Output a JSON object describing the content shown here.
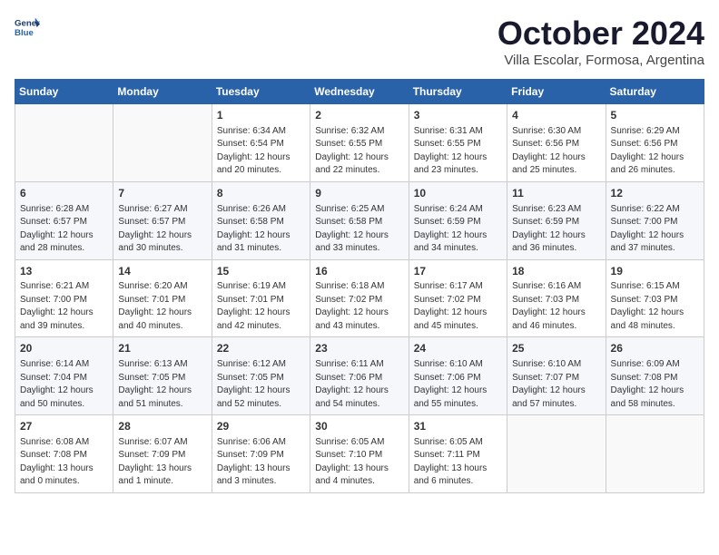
{
  "header": {
    "logo_line1": "General",
    "logo_line2": "Blue",
    "month": "October 2024",
    "location": "Villa Escolar, Formosa, Argentina"
  },
  "weekdays": [
    "Sunday",
    "Monday",
    "Tuesday",
    "Wednesday",
    "Thursday",
    "Friday",
    "Saturday"
  ],
  "weeks": [
    [
      {
        "day": "",
        "info": ""
      },
      {
        "day": "",
        "info": ""
      },
      {
        "day": "1",
        "info": "Sunrise: 6:34 AM\nSunset: 6:54 PM\nDaylight: 12 hours\nand 20 minutes."
      },
      {
        "day": "2",
        "info": "Sunrise: 6:32 AM\nSunset: 6:55 PM\nDaylight: 12 hours\nand 22 minutes."
      },
      {
        "day": "3",
        "info": "Sunrise: 6:31 AM\nSunset: 6:55 PM\nDaylight: 12 hours\nand 23 minutes."
      },
      {
        "day": "4",
        "info": "Sunrise: 6:30 AM\nSunset: 6:56 PM\nDaylight: 12 hours\nand 25 minutes."
      },
      {
        "day": "5",
        "info": "Sunrise: 6:29 AM\nSunset: 6:56 PM\nDaylight: 12 hours\nand 26 minutes."
      }
    ],
    [
      {
        "day": "6",
        "info": "Sunrise: 6:28 AM\nSunset: 6:57 PM\nDaylight: 12 hours\nand 28 minutes."
      },
      {
        "day": "7",
        "info": "Sunrise: 6:27 AM\nSunset: 6:57 PM\nDaylight: 12 hours\nand 30 minutes."
      },
      {
        "day": "8",
        "info": "Sunrise: 6:26 AM\nSunset: 6:58 PM\nDaylight: 12 hours\nand 31 minutes."
      },
      {
        "day": "9",
        "info": "Sunrise: 6:25 AM\nSunset: 6:58 PM\nDaylight: 12 hours\nand 33 minutes."
      },
      {
        "day": "10",
        "info": "Sunrise: 6:24 AM\nSunset: 6:59 PM\nDaylight: 12 hours\nand 34 minutes."
      },
      {
        "day": "11",
        "info": "Sunrise: 6:23 AM\nSunset: 6:59 PM\nDaylight: 12 hours\nand 36 minutes."
      },
      {
        "day": "12",
        "info": "Sunrise: 6:22 AM\nSunset: 7:00 PM\nDaylight: 12 hours\nand 37 minutes."
      }
    ],
    [
      {
        "day": "13",
        "info": "Sunrise: 6:21 AM\nSunset: 7:00 PM\nDaylight: 12 hours\nand 39 minutes."
      },
      {
        "day": "14",
        "info": "Sunrise: 6:20 AM\nSunset: 7:01 PM\nDaylight: 12 hours\nand 40 minutes."
      },
      {
        "day": "15",
        "info": "Sunrise: 6:19 AM\nSunset: 7:01 PM\nDaylight: 12 hours\nand 42 minutes."
      },
      {
        "day": "16",
        "info": "Sunrise: 6:18 AM\nSunset: 7:02 PM\nDaylight: 12 hours\nand 43 minutes."
      },
      {
        "day": "17",
        "info": "Sunrise: 6:17 AM\nSunset: 7:02 PM\nDaylight: 12 hours\nand 45 minutes."
      },
      {
        "day": "18",
        "info": "Sunrise: 6:16 AM\nSunset: 7:03 PM\nDaylight: 12 hours\nand 46 minutes."
      },
      {
        "day": "19",
        "info": "Sunrise: 6:15 AM\nSunset: 7:03 PM\nDaylight: 12 hours\nand 48 minutes."
      }
    ],
    [
      {
        "day": "20",
        "info": "Sunrise: 6:14 AM\nSunset: 7:04 PM\nDaylight: 12 hours\nand 50 minutes."
      },
      {
        "day": "21",
        "info": "Sunrise: 6:13 AM\nSunset: 7:05 PM\nDaylight: 12 hours\nand 51 minutes."
      },
      {
        "day": "22",
        "info": "Sunrise: 6:12 AM\nSunset: 7:05 PM\nDaylight: 12 hours\nand 52 minutes."
      },
      {
        "day": "23",
        "info": "Sunrise: 6:11 AM\nSunset: 7:06 PM\nDaylight: 12 hours\nand 54 minutes."
      },
      {
        "day": "24",
        "info": "Sunrise: 6:10 AM\nSunset: 7:06 PM\nDaylight: 12 hours\nand 55 minutes."
      },
      {
        "day": "25",
        "info": "Sunrise: 6:10 AM\nSunset: 7:07 PM\nDaylight: 12 hours\nand 57 minutes."
      },
      {
        "day": "26",
        "info": "Sunrise: 6:09 AM\nSunset: 7:08 PM\nDaylight: 12 hours\nand 58 minutes."
      }
    ],
    [
      {
        "day": "27",
        "info": "Sunrise: 6:08 AM\nSunset: 7:08 PM\nDaylight: 13 hours\nand 0 minutes."
      },
      {
        "day": "28",
        "info": "Sunrise: 6:07 AM\nSunset: 7:09 PM\nDaylight: 13 hours\nand 1 minute."
      },
      {
        "day": "29",
        "info": "Sunrise: 6:06 AM\nSunset: 7:09 PM\nDaylight: 13 hours\nand 3 minutes."
      },
      {
        "day": "30",
        "info": "Sunrise: 6:05 AM\nSunset: 7:10 PM\nDaylight: 13 hours\nand 4 minutes."
      },
      {
        "day": "31",
        "info": "Sunrise: 6:05 AM\nSunset: 7:11 PM\nDaylight: 13 hours\nand 6 minutes."
      },
      {
        "day": "",
        "info": ""
      },
      {
        "day": "",
        "info": ""
      }
    ]
  ]
}
